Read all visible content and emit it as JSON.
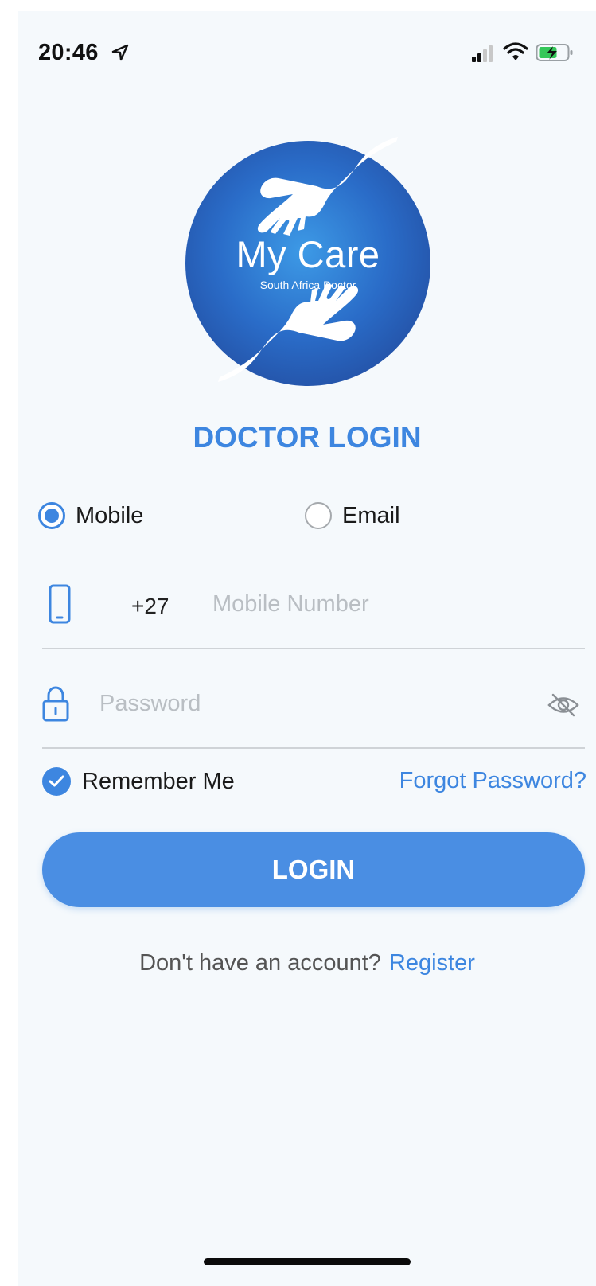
{
  "status_bar": {
    "time": "20:46"
  },
  "logo": {
    "title": "My Care",
    "subtitle": "South Africa Doctor"
  },
  "screen_title": "DOCTOR LOGIN",
  "login_type": {
    "options": [
      {
        "label": "Mobile",
        "selected": true
      },
      {
        "label": "Email",
        "selected": false
      }
    ]
  },
  "mobile_field": {
    "country_code": "+27",
    "placeholder": "Mobile Number",
    "value": ""
  },
  "password_field": {
    "placeholder": "Password",
    "value": ""
  },
  "remember_me": {
    "label": "Remember Me",
    "checked": true
  },
  "forgot_password": "Forgot Password?",
  "login_button": "LOGIN",
  "register": {
    "prompt": "Don't have an account?",
    "link": "Register"
  },
  "colors": {
    "accent": "#3d86e0",
    "button": "#4a8ee3",
    "background": "#f5f9fc",
    "logo_blue": "#2a63c0"
  }
}
